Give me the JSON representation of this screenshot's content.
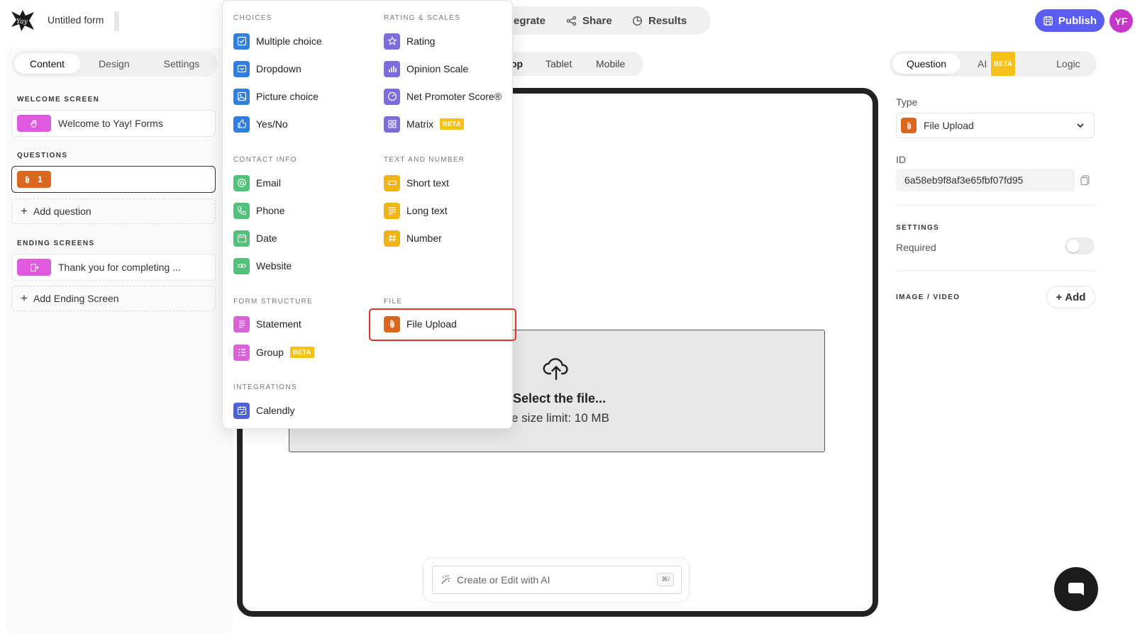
{
  "header": {
    "form_title": "Untitled form",
    "nav": [
      {
        "label": "egrate",
        "icon": "integrate-icon"
      },
      {
        "label": "Share",
        "icon": "share-icon"
      },
      {
        "label": "Results",
        "icon": "results-icon"
      }
    ],
    "publish_label": "Publish",
    "avatar_initials": "YF"
  },
  "left": {
    "tabs": [
      "Content",
      "Design",
      "Settings"
    ],
    "active_tab": "Content",
    "welcome_label": "WELCOME SCREEN",
    "welcome_item": "Welcome to Yay! Forms",
    "questions_label": "QUESTIONS",
    "question_number": "1",
    "add_question": "Add question",
    "ending_label": "ENDING SCREENS",
    "ending_item": "Thank you for completing ...",
    "add_ending": "Add Ending Screen"
  },
  "center": {
    "devices": [
      "op",
      "Tablet",
      "Mobile"
    ],
    "upload_title": "Select the file...",
    "upload_sub": "e size limit: 10 MB",
    "ai_placeholder": "Create or Edit with AI",
    "ai_shortcut": "⌘/"
  },
  "right": {
    "tabs": [
      "Question",
      "AI",
      "Logic"
    ],
    "ai_badge": "BETA",
    "type_label": "Type",
    "type_value": "File Upload",
    "id_label": "ID",
    "id_value": "6a58eb9f8af3e65fbf07fd95",
    "settings_label": "SETTINGS",
    "required_label": "Required",
    "required_on": false,
    "media_label": "IMAGE / VIDEO",
    "add_label": "Add"
  },
  "menu": {
    "choices_head": "CHOICES",
    "choices": [
      "Multiple choice",
      "Dropdown",
      "Picture choice",
      "Yes/No"
    ],
    "rating_head": "RATING & SCALES",
    "rating": [
      "Rating",
      "Opinion Scale",
      "Net Promoter Score®",
      "Matrix"
    ],
    "contact_head": "CONTACT INFO",
    "contact": [
      "Email",
      "Phone",
      "Date",
      "Website"
    ],
    "text_head": "TEXT AND NUMBER",
    "text": [
      "Short text",
      "Long text",
      "Number"
    ],
    "structure_head": "FORM STRUCTURE",
    "structure": [
      "Statement",
      "Group"
    ],
    "file_head": "FILE",
    "file": [
      "File Upload"
    ],
    "integrations_head": "INTEGRATIONS",
    "integrations": [
      "Calendly"
    ],
    "beta": "BETA",
    "highlighted_item": "File Upload"
  },
  "colors": {
    "accent": "#5b5ef0",
    "avatar": "#c437c9",
    "file_upload": "#d9681e",
    "highlight": "#e0342a",
    "beta_badge": "#f7c11c"
  }
}
